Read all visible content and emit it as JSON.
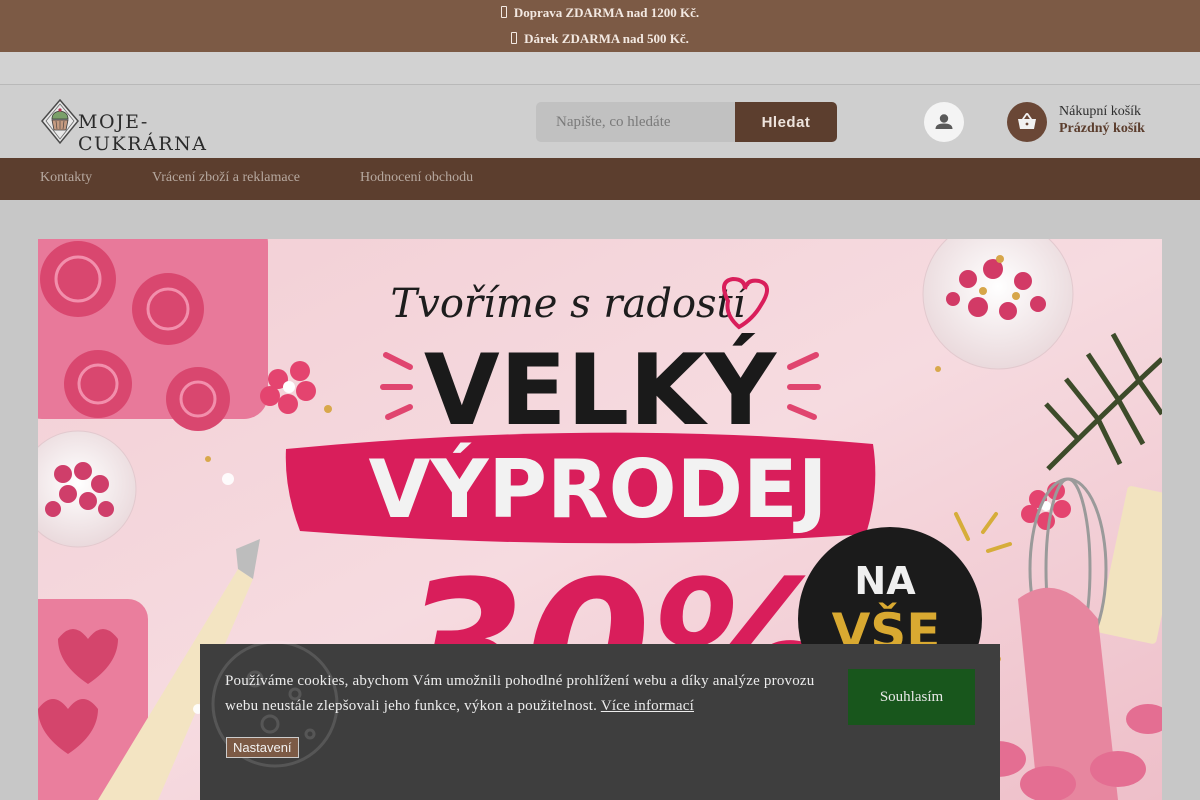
{
  "topbar": {
    "line1": "Doprava ZDARMA nad 1200 Kč.",
    "line2": "Dárek ZDARMA nad 500 Kč."
  },
  "header": {
    "logo_text": "MOJE-CUKRÁRNA",
    "search": {
      "placeholder": "Napište, co hledáte",
      "button_label": "Hledat"
    },
    "cart": {
      "title": "Nákupní košík",
      "status": "Prázdný košík"
    }
  },
  "nav": {
    "items": [
      {
        "label": "Kontakty"
      },
      {
        "label": "Vrácení zboží a reklamace"
      },
      {
        "label": "Hodnocení obchodu"
      }
    ]
  },
  "banner": {
    "script_line": "Tvoříme s radostí",
    "headline_1": "VELKÝ",
    "headline_2": "VÝPRODEJ",
    "discount": "-30%",
    "badge_line1": "NA",
    "badge_line2": "VŠE"
  },
  "cookie": {
    "text": "Používáme cookies, abychom Vám umožnili pohodlné prohlížení webu a díky analýze provozu webu neustále zlepšovali jeho funkce, výkon a použitelnost.",
    "link_label": "Více informací",
    "accept_label": "Souhlasím",
    "settings_label": "Nastavení"
  },
  "colors": {
    "brand_brown": "#5c3e2e",
    "topbar_brown": "#7c5a45",
    "accept_green": "#18561c",
    "banner_pink": "#d91e5b"
  },
  "icons": {
    "topbar": "phone-icon",
    "account": "user-icon",
    "cart": "basket-icon"
  }
}
